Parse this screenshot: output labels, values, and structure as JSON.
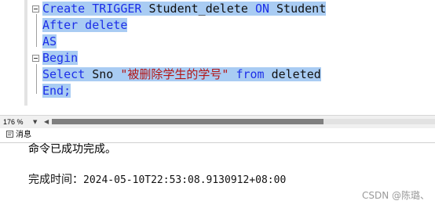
{
  "editor": {
    "lines": [
      [
        {
          "t": "Create TRIGGER ",
          "c": "kw"
        },
        {
          "t": "Student_delete ",
          "c": "tx"
        },
        {
          "t": "ON ",
          "c": "kw"
        },
        {
          "t": "Student",
          "c": "tx"
        }
      ],
      [
        {
          "t": "After delete",
          "c": "kw"
        }
      ],
      [
        {
          "t": "AS",
          "c": "kw"
        }
      ],
      [
        {
          "t": "Begin",
          "c": "kw"
        }
      ],
      [
        {
          "t": "Select ",
          "c": "kw"
        },
        {
          "t": "Sno ",
          "c": "tx"
        },
        {
          "t": "\"被删除学生的学号\" ",
          "c": "str"
        },
        {
          "t": "from ",
          "c": "kw"
        },
        {
          "t": "deleted",
          "c": "tx"
        }
      ],
      [
        {
          "t": "End;",
          "c": "kw"
        }
      ]
    ]
  },
  "status": {
    "zoom": "176 %"
  },
  "tabs": {
    "messages_label": "消息"
  },
  "output": {
    "message": "命令已成功完成。",
    "completion_label": "完成时间：",
    "completion_time": "2024-05-10T22:53:08.9130912+08:00"
  },
  "watermark": "CSDN @陈璐、"
}
